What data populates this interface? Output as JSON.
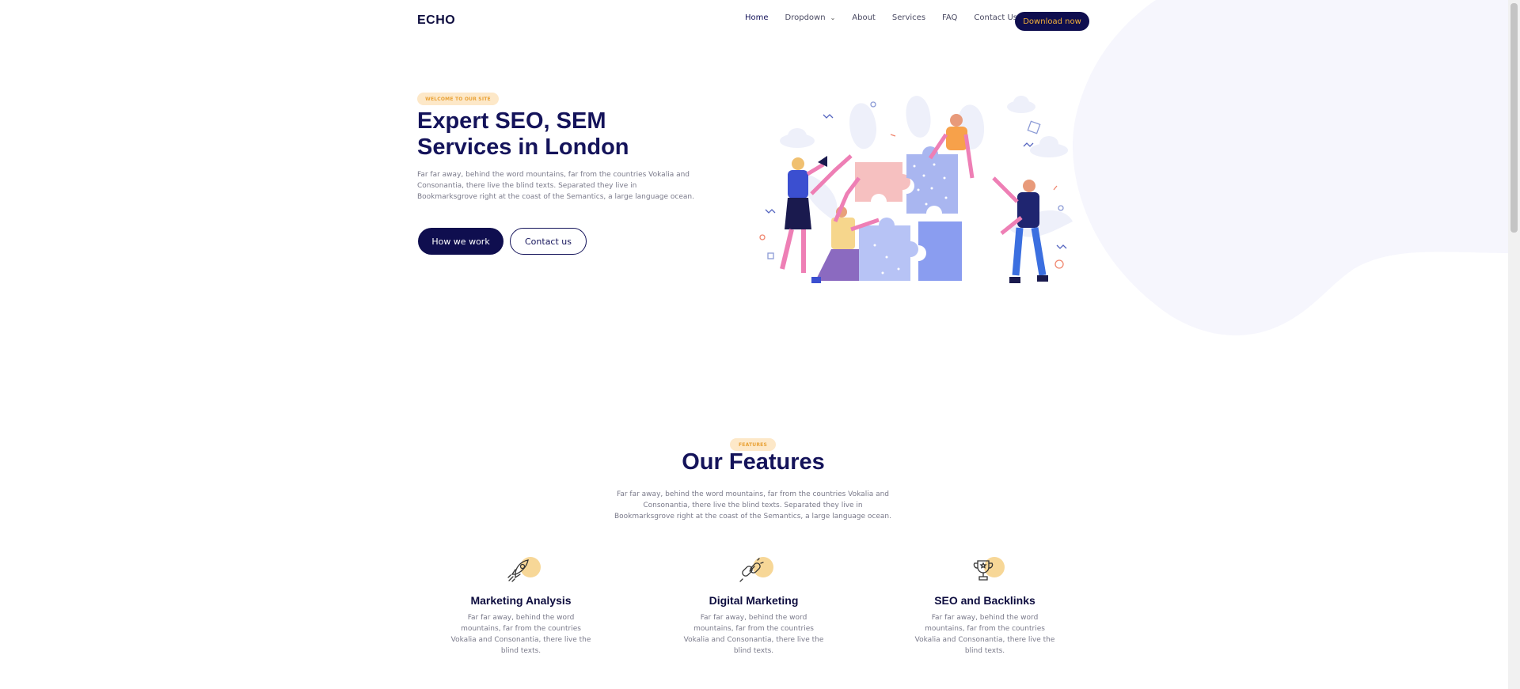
{
  "brand": {
    "logo": "ECHO"
  },
  "nav": {
    "items": [
      {
        "label": "Home",
        "active": true
      },
      {
        "label": "Dropdown",
        "has_caret": true
      },
      {
        "label": "About"
      },
      {
        "label": "Services"
      },
      {
        "label": "FAQ"
      },
      {
        "label": "Contact Us"
      }
    ],
    "download_label": "Download now"
  },
  "hero": {
    "badge": "WELCOME TO OUR SITE",
    "title_line1": "Expert SEO, SEM",
    "title_line2": "Services in London",
    "description": "Far far away, behind the word mountains, far from the countries Vokalia and Consonantia, there live the blind texts. Separated they live in Bookmarksgrove right at the coast of the Semantics, a large language ocean.",
    "primary_button": "How we work",
    "secondary_button": "Contact us"
  },
  "features": {
    "badge": "FEATURES",
    "title": "Our Features",
    "description": "Far far away, behind the word mountains, far from the countries Vokalia and Consonantia, there live the blind texts. Separated they live in Bookmarksgrove right at the coast of the Semantics, a large language ocean.",
    "cards": [
      {
        "icon": "rocket-icon",
        "title": "Marketing Analysis",
        "text": "Far far away, behind the word mountains, far from the countries Vokalia and Consonantia, there live the blind texts."
      },
      {
        "icon": "link-icon",
        "title": "Digital Marketing",
        "text": "Far far away, behind the word mountains, far from the countries Vokalia and Consonantia, there live the blind texts."
      },
      {
        "icon": "trophy-icon",
        "title": "SEO and Backlinks",
        "text": "Far far away, behind the word mountains, far from the countries Vokalia and Consonantia, there live the blind texts."
      }
    ]
  },
  "colors": {
    "primary": "#0f0e4f",
    "accent": "#f5b13a",
    "badge_bg": "#fde8c8",
    "blob": "#f6f6fd"
  }
}
